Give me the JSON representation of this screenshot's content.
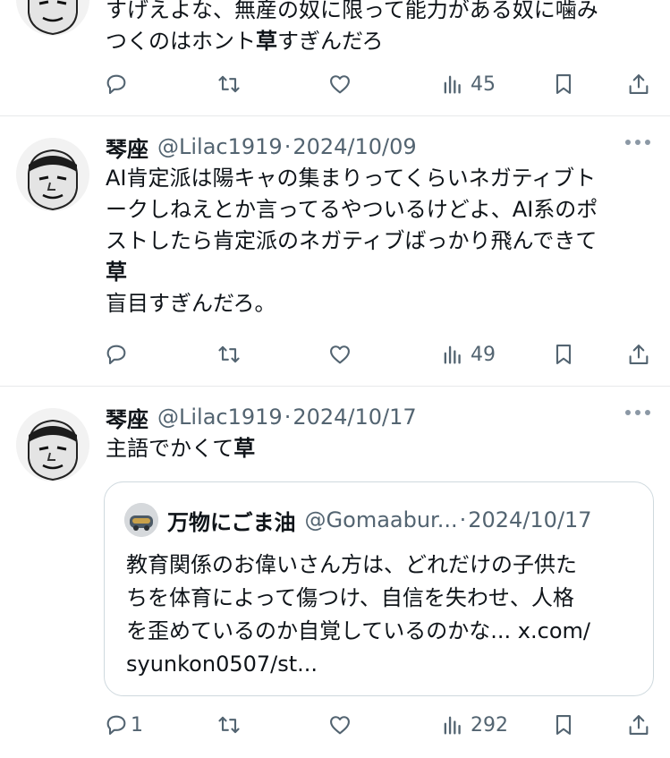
{
  "tweets": [
    {
      "text_lines": [
        [
          {
            "t": "すげえよな、無産の奴に限って能力がある奴に噛み",
            "b": false
          }
        ],
        [
          {
            "t": "つくのはホント",
            "b": false
          },
          {
            "t": "草",
            "b": true
          },
          {
            "t": "すぎんだろ",
            "b": false
          }
        ]
      ],
      "actions": {
        "reply": "",
        "retweet": "",
        "like": "",
        "views": "45"
      }
    },
    {
      "name": "琴座",
      "handle": "@Lilac1919",
      "dot": "·",
      "date": "2024/10/09",
      "text_lines": [
        [
          {
            "t": "AI肯定派は陽キャの集まりってくらいネガティブト",
            "b": false
          }
        ],
        [
          {
            "t": "ークしねえとか言ってるやついるけどよ、AI系のポ",
            "b": false
          }
        ],
        [
          {
            "t": "ストしたら肯定派のネガティブばっかり飛んできて",
            "b": false
          }
        ],
        [
          {
            "t": "草",
            "b": true
          }
        ],
        [
          {
            "t": "盲目すぎんだろ。",
            "b": false
          }
        ]
      ],
      "actions": {
        "reply": "",
        "retweet": "",
        "like": "",
        "views": "49"
      }
    },
    {
      "name": "琴座",
      "handle": "@Lilac1919",
      "dot": "·",
      "date": "2024/10/17",
      "text_lines": [
        [
          {
            "t": "主語でかくて",
            "b": false
          },
          {
            "t": "草",
            "b": true
          }
        ]
      ],
      "quote": {
        "name": "万物にごま油",
        "handle": "@Gomaabur...",
        "dot": "·",
        "date": "2024/10/17",
        "text_lines": [
          "教育関係のお偉いさん方は、どれだけの子供た",
          "ちを体育によって傷つけ、自信を失わせ、人格",
          "を歪めているのか自覚しているのかな... x.com/",
          "syunkon0507/st..."
        ]
      },
      "actions": {
        "reply": "1",
        "retweet": "",
        "like": "",
        "views": "292"
      }
    }
  ],
  "icons": {
    "reply": "reply-icon",
    "retweet": "retweet-icon",
    "like": "heart-icon",
    "views": "views-icon",
    "bookmark": "bookmark-icon",
    "share": "share-icon",
    "more": "more-icon"
  },
  "colors": {
    "text": "#0f1419",
    "secondary": "#536471",
    "divider": "#e7e9ea",
    "quote_border": "#cfd9de"
  }
}
